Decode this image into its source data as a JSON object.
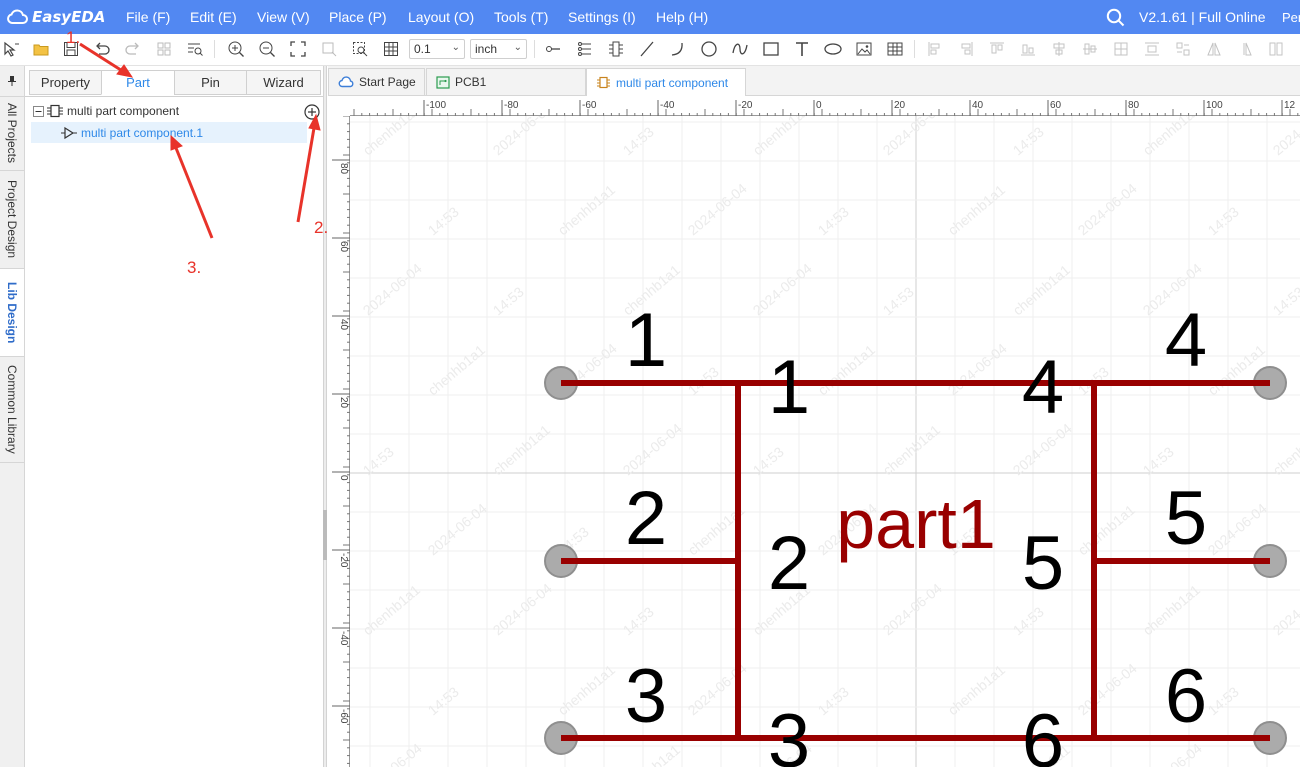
{
  "app": {
    "name": "EasyEDA",
    "version": "V2.1.61 | Full Online",
    "user_truncated": "Per"
  },
  "menu": [
    "File (F)",
    "Edit (E)",
    "View (V)",
    "Place (P)",
    "Layout (O)",
    "Tools (T)",
    "Settings (I)",
    "Help (H)"
  ],
  "toolbar": {
    "grid_value": "0.1",
    "unit": "inch"
  },
  "vertical_tabs": [
    "All Projects",
    "Project Design",
    "Lib Design",
    "Common Library"
  ],
  "vertical_tab_active": "Lib Design",
  "panel_tabs": [
    "Property",
    "Part",
    "Pin",
    "Wizard"
  ],
  "panel_tab_active": "Part",
  "tree": {
    "root": "multi part component",
    "child": "multi part component.1"
  },
  "doc_tabs": [
    "Start Page",
    "PCB1",
    "multi part component"
  ],
  "doc_tab_active": "multi part component",
  "ruler_top": [
    "-100",
    "-80",
    "-60",
    "-40",
    "-20",
    "0",
    "20",
    "40",
    "60",
    "80",
    "100",
    "12"
  ],
  "ruler_left": [
    "80",
    "60",
    "40",
    "20",
    "0",
    "-20",
    "-40",
    "-60"
  ],
  "schematic": {
    "part_label": "part1",
    "pin_names": [
      "1",
      "2",
      "3",
      "4",
      "5",
      "6"
    ],
    "pin_numbers": [
      "1",
      "2",
      "3",
      "4",
      "5",
      "6"
    ],
    "line_color": "#990000",
    "pin_end_color": "#9a9a9a"
  },
  "watermark": {
    "user": "chenhb1a1",
    "date": "2024-06-04",
    "time": "14:53"
  },
  "annotations": [
    "1.",
    "2.",
    "3."
  ],
  "colors": {
    "menubar": "#5288f2",
    "accent": "#2e88e8",
    "annotation": "#e8332a"
  }
}
